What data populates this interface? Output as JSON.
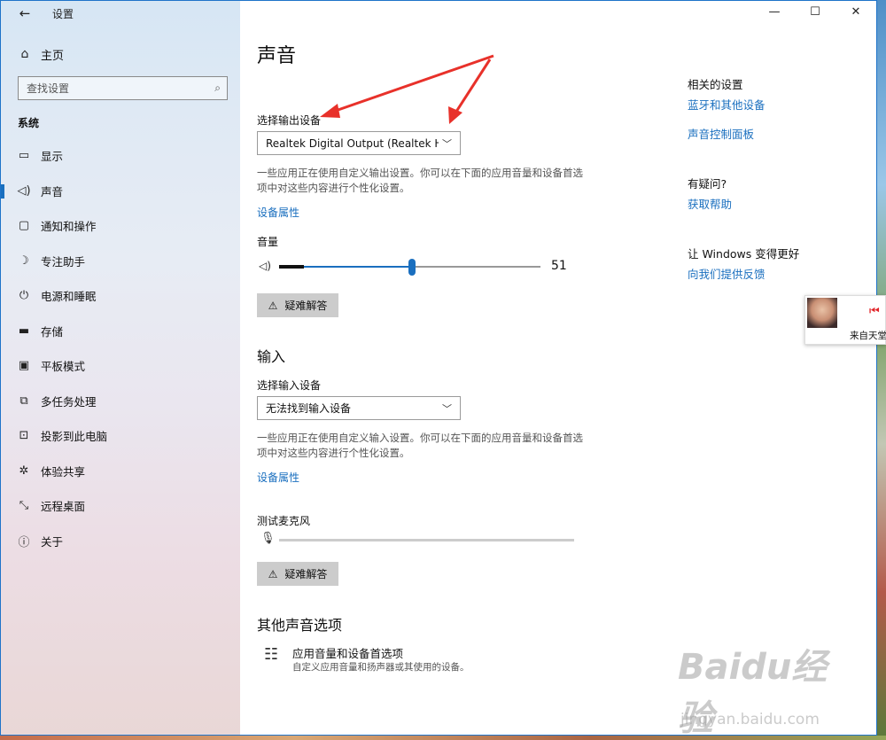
{
  "window": {
    "title": "设置",
    "back_icon": "back-arrow-icon",
    "controls": [
      "—",
      "☐",
      "✕"
    ]
  },
  "sidebar": {
    "home_label": "主页",
    "search_placeholder": "查找设置",
    "section": "系统",
    "items": [
      {
        "label": "显示",
        "icon": "monitor-icon",
        "glyph": "▭"
      },
      {
        "label": "声音",
        "icon": "speaker-icon",
        "glyph": "🔈︎"
      },
      {
        "label": "通知和操作",
        "icon": "notification-icon",
        "glyph": "▢"
      },
      {
        "label": "专注助手",
        "icon": "moon-icon",
        "glyph": "☽"
      },
      {
        "label": "电源和睡眠",
        "icon": "power-icon",
        "glyph": "⏻"
      },
      {
        "label": "存储",
        "icon": "storage-icon",
        "glyph": "▬"
      },
      {
        "label": "平板模式",
        "icon": "tablet-icon",
        "glyph": "▣"
      },
      {
        "label": "多任务处理",
        "icon": "multitask-icon",
        "glyph": "⧉"
      },
      {
        "label": "投影到此电脑",
        "icon": "project-icon",
        "glyph": "⊡"
      },
      {
        "label": "体验共享",
        "icon": "share-icon",
        "glyph": "✲"
      },
      {
        "label": "远程桌面",
        "icon": "remote-icon",
        "glyph": "⤡"
      },
      {
        "label": "关于",
        "icon": "info-icon",
        "glyph": "ⓘ"
      }
    ],
    "active_index": 1
  },
  "main": {
    "title": "声音",
    "output": {
      "label": "选择输出设备",
      "device": "Realtek Digital Output (Realtek Hi...",
      "desc": "一些应用正在使用自定义输出设置。你可以在下面的应用音量和设备首选项中对这些内容进行个性化设置。",
      "props_link": "设备属性",
      "volume_label": "音量",
      "volume_value": "51",
      "volume_level": 0.51,
      "troubleshoot": "疑难解答"
    },
    "input": {
      "heading": "输入",
      "label": "选择输入设备",
      "device": "无法找到输入设备",
      "desc": "一些应用正在使用自定义输入设置。你可以在下面的应用音量和设备首选项中对这些内容进行个性化设置。",
      "props_link": "设备属性",
      "test_mic": "测试麦克风",
      "troubleshoot": "疑难解答"
    },
    "other": {
      "heading": "其他声音选项",
      "title": "应用音量和设备首选项",
      "sub": "自定义应用音量和扬声器或其使用的设备。"
    }
  },
  "right": {
    "related_head": "相关的设置",
    "related_links": [
      "蓝牙和其他设备",
      "声音控制面板"
    ],
    "question_head": "有疑问?",
    "help_link": "获取帮助",
    "improve_head": "让 Windows 变得更好",
    "feedback_link": "向我们提供反馈"
  },
  "widget": {
    "caption": "来自天堂",
    "accent": "#e1252a"
  },
  "watermark": {
    "logo": "Baidu经验",
    "url": "jingyan.baidu.com"
  },
  "colors": {
    "accent": "#1a6fbf",
    "arrow": "#e8312a"
  }
}
